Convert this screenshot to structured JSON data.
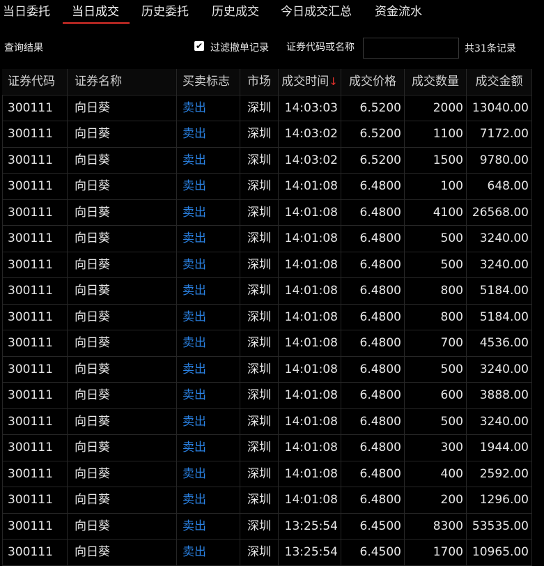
{
  "tabs": [
    {
      "label": "当日委托"
    },
    {
      "label": "当日成交"
    },
    {
      "label": "历史委托"
    },
    {
      "label": "历史成交"
    },
    {
      "label": "今日成交汇总"
    },
    {
      "label": "资金流水"
    }
  ],
  "active_tab": "当日成交",
  "toolbar": {
    "query_title": "查询结果",
    "filter_checked": "✔",
    "filter_label": "过滤撤单记录",
    "search_label": "证券代码或名称",
    "search_value": "",
    "record_count": "共31条记录"
  },
  "table": {
    "headers": [
      "证券代码",
      "证券名称",
      "买卖标志",
      "市场",
      "成交时间",
      "成交价格",
      "成交数量",
      "成交金额"
    ],
    "sort_indicator": "↓",
    "rows": [
      [
        "300111",
        "向日葵",
        "卖出",
        "深圳",
        "14:03:03",
        "6.5200",
        "2000",
        "13040.00"
      ],
      [
        "300111",
        "向日葵",
        "卖出",
        "深圳",
        "14:03:02",
        "6.5200",
        "1100",
        "7172.00"
      ],
      [
        "300111",
        "向日葵",
        "卖出",
        "深圳",
        "14:03:02",
        "6.5200",
        "1500",
        "9780.00"
      ],
      [
        "300111",
        "向日葵",
        "卖出",
        "深圳",
        "14:01:08",
        "6.4800",
        "100",
        "648.00"
      ],
      [
        "300111",
        "向日葵",
        "卖出",
        "深圳",
        "14:01:08",
        "6.4800",
        "4100",
        "26568.00"
      ],
      [
        "300111",
        "向日葵",
        "卖出",
        "深圳",
        "14:01:08",
        "6.4800",
        "500",
        "3240.00"
      ],
      [
        "300111",
        "向日葵",
        "卖出",
        "深圳",
        "14:01:08",
        "6.4800",
        "500",
        "3240.00"
      ],
      [
        "300111",
        "向日葵",
        "卖出",
        "深圳",
        "14:01:08",
        "6.4800",
        "800",
        "5184.00"
      ],
      [
        "300111",
        "向日葵",
        "卖出",
        "深圳",
        "14:01:08",
        "6.4800",
        "800",
        "5184.00"
      ],
      [
        "300111",
        "向日葵",
        "卖出",
        "深圳",
        "14:01:08",
        "6.4800",
        "700",
        "4536.00"
      ],
      [
        "300111",
        "向日葵",
        "卖出",
        "深圳",
        "14:01:08",
        "6.4800",
        "500",
        "3240.00"
      ],
      [
        "300111",
        "向日葵",
        "卖出",
        "深圳",
        "14:01:08",
        "6.4800",
        "600",
        "3888.00"
      ],
      [
        "300111",
        "向日葵",
        "卖出",
        "深圳",
        "14:01:08",
        "6.4800",
        "500",
        "3240.00"
      ],
      [
        "300111",
        "向日葵",
        "卖出",
        "深圳",
        "14:01:08",
        "6.4800",
        "300",
        "1944.00"
      ],
      [
        "300111",
        "向日葵",
        "卖出",
        "深圳",
        "14:01:08",
        "6.4800",
        "400",
        "2592.00"
      ],
      [
        "300111",
        "向日葵",
        "卖出",
        "深圳",
        "14:01:08",
        "6.4800",
        "200",
        "1296.00"
      ],
      [
        "300111",
        "向日葵",
        "卖出",
        "深圳",
        "13:25:54",
        "6.4500",
        "8300",
        "53535.00"
      ],
      [
        "300111",
        "向日葵",
        "卖出",
        "深圳",
        "13:25:54",
        "6.4500",
        "1700",
        "10965.00"
      ]
    ]
  },
  "colors": {
    "background": "#000000",
    "text": "#e6e6e6",
    "sell": "#2a82e4",
    "accent_red": "#e0302a",
    "grid_line": "#262626"
  }
}
